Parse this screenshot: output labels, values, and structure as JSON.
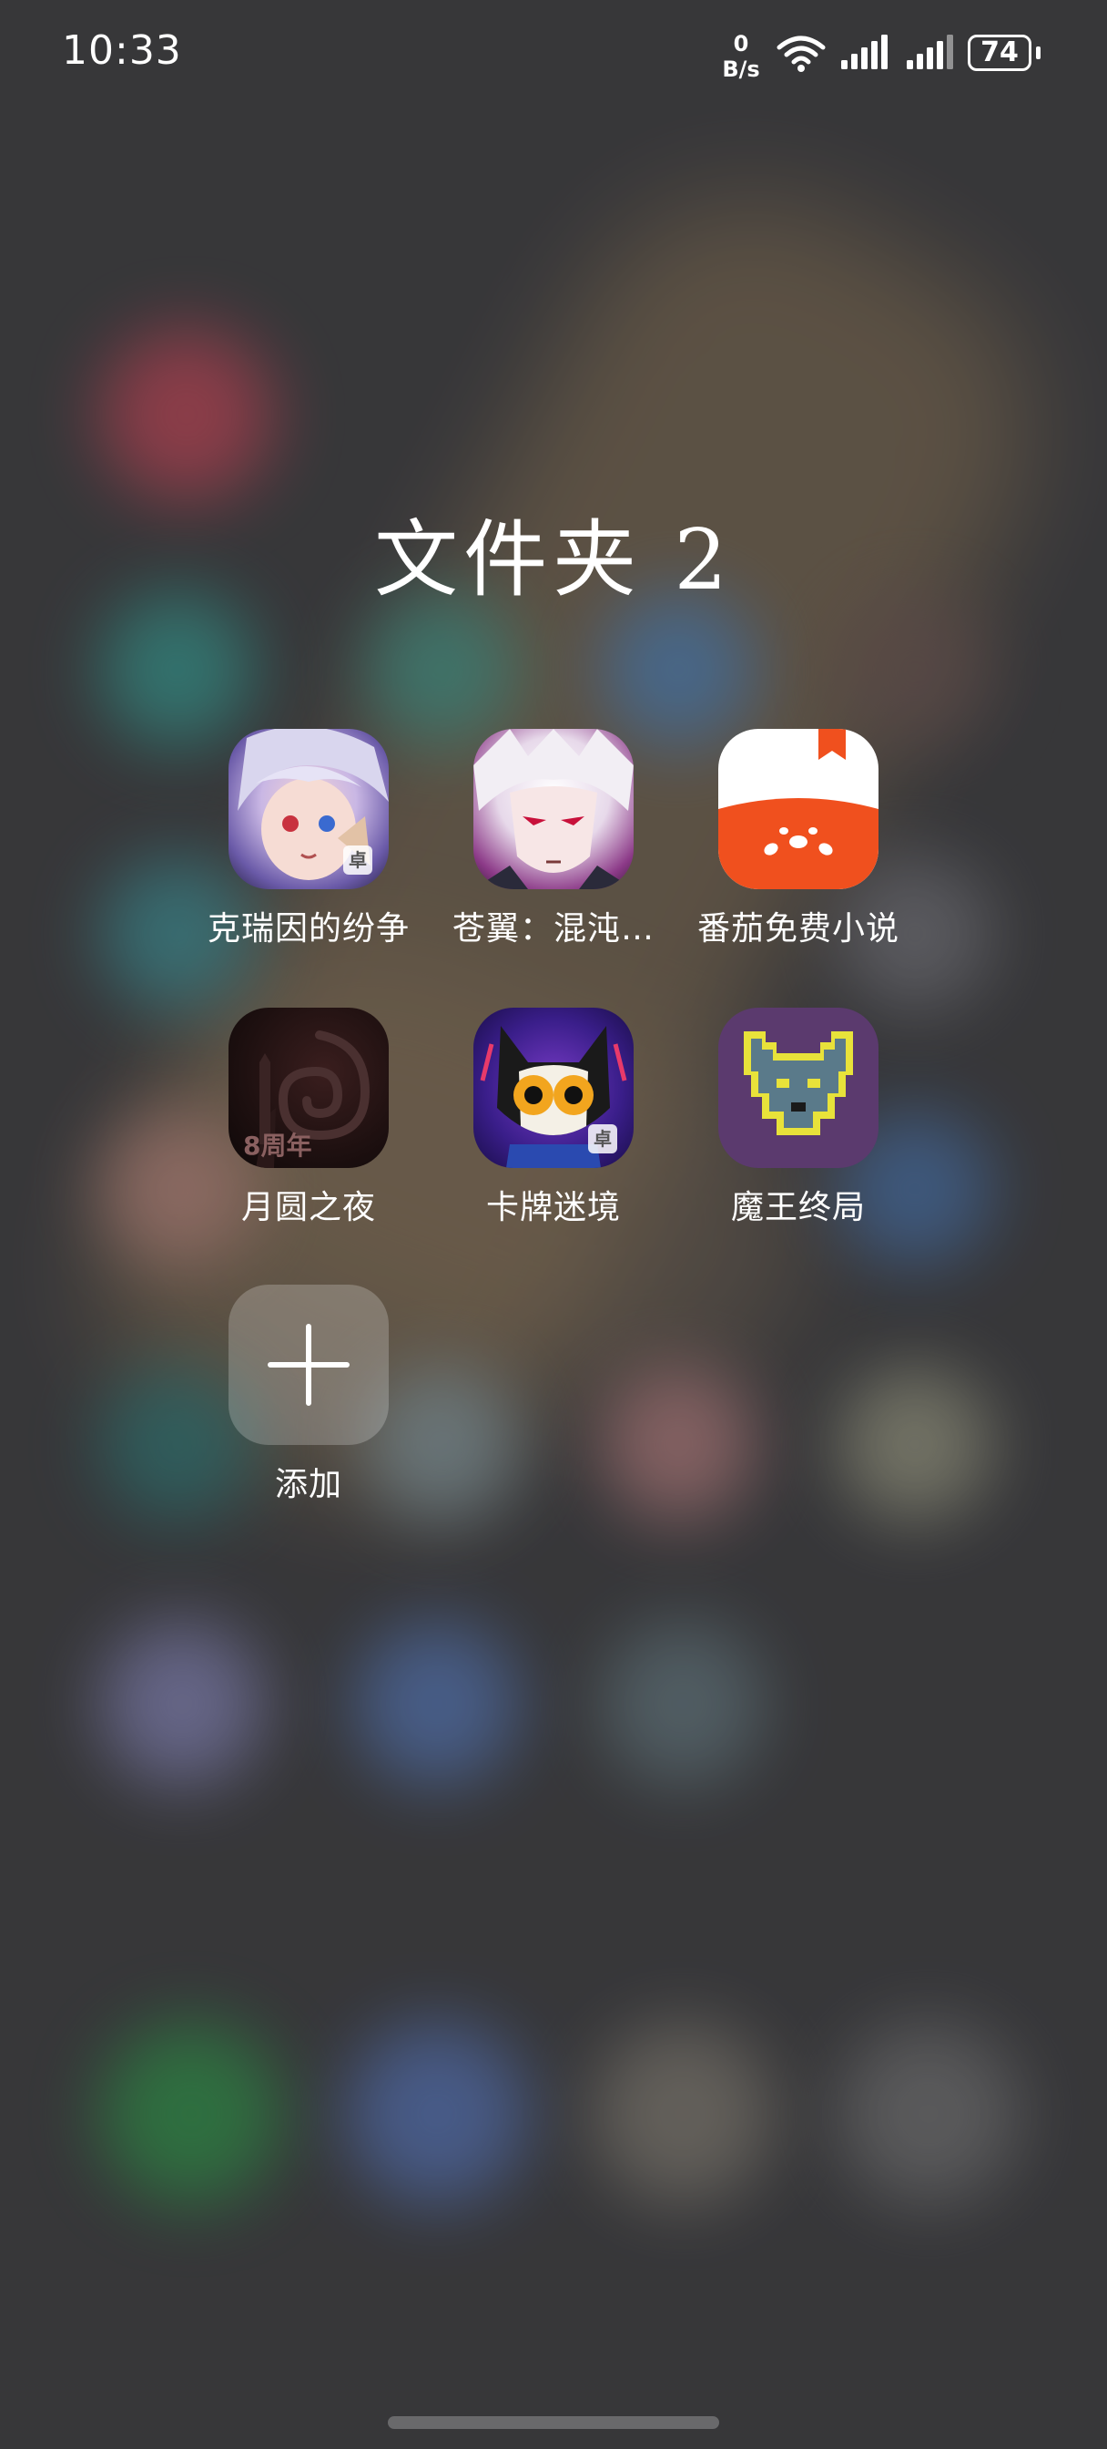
{
  "status_bar": {
    "time": "10:33",
    "net_speed_value": "0",
    "net_speed_unit": "B/s",
    "battery": "74",
    "icons": [
      "wifi-icon",
      "signal-icon",
      "signal-icon"
    ]
  },
  "folder": {
    "title": "文件夹 2",
    "apps": [
      {
        "label": "克瑞因的纷争",
        "icon": "anime-girl-icon",
        "badge": "卓"
      },
      {
        "label": "苍翼：混沌…",
        "icon": "anime-boy-icon",
        "badge": ""
      },
      {
        "label": "番茄免费小说",
        "icon": "tomato-icon",
        "badge": ""
      },
      {
        "label": "月圆之夜",
        "icon": "full-moon-night-icon",
        "badge": "",
        "sub": "8周年"
      },
      {
        "label": "卡牌迷境",
        "icon": "cat-mask-icon",
        "badge": "卓"
      },
      {
        "label": "魔王终局",
        "icon": "pixel-wolf-icon",
        "badge": ""
      }
    ],
    "add_label": "添加"
  },
  "colors": {
    "background": "#3c3c3e",
    "tomato": "#f0501e",
    "pixel_wolf_bg": "#5b3a6e"
  }
}
